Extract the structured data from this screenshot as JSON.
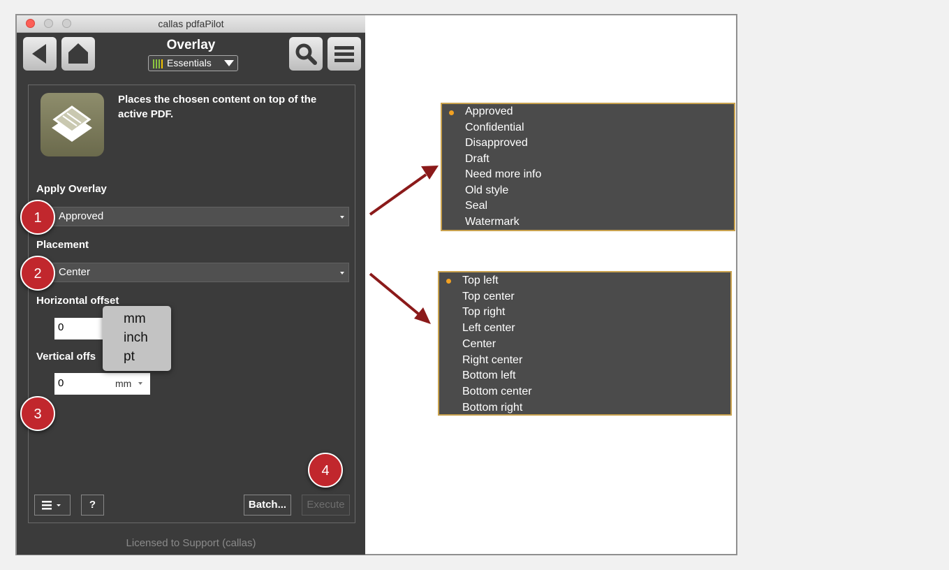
{
  "window": {
    "title": "callas pdfaPilot"
  },
  "toolbar": {
    "title": "Overlay",
    "profile_label": "Essentials"
  },
  "description": "Places the chosen content on top of the active PDF.",
  "apply_overlay": {
    "label": "Apply Overlay",
    "value": "Approved"
  },
  "placement": {
    "label": "Placement",
    "value": "Center"
  },
  "horizontal_offset": {
    "label": "Horizontal offset",
    "value": "0"
  },
  "vertical_offset": {
    "label": "Vertical offs",
    "value": "0",
    "unit": "mm"
  },
  "unit_menu": [
    "mm",
    "inch",
    "pt"
  ],
  "bottom": {
    "help_label": "?",
    "batch_label": "Batch...",
    "execute_label": "Execute"
  },
  "footer": "Licensed to Support (callas)",
  "badges": [
    "1",
    "2",
    "3",
    "4"
  ],
  "overlay_options": [
    "Approved",
    "Confidential",
    "Disapproved",
    "Draft",
    "Need more info",
    "Old style",
    "Seal",
    "Watermark"
  ],
  "overlay_selected": "Approved",
  "placement_options": [
    "Top left",
    "Top center",
    "Top right",
    "Left center",
    "Center",
    "Right center",
    "Bottom left",
    "Bottom center",
    "Bottom right"
  ],
  "placement_selected": "Top left",
  "colors": {
    "badge": "#c1272d",
    "arrow": "#8b1a1a",
    "list_border": "#c9a24e",
    "selected_dot": "#f2a122",
    "panel_bg": "#3b3b3b"
  }
}
